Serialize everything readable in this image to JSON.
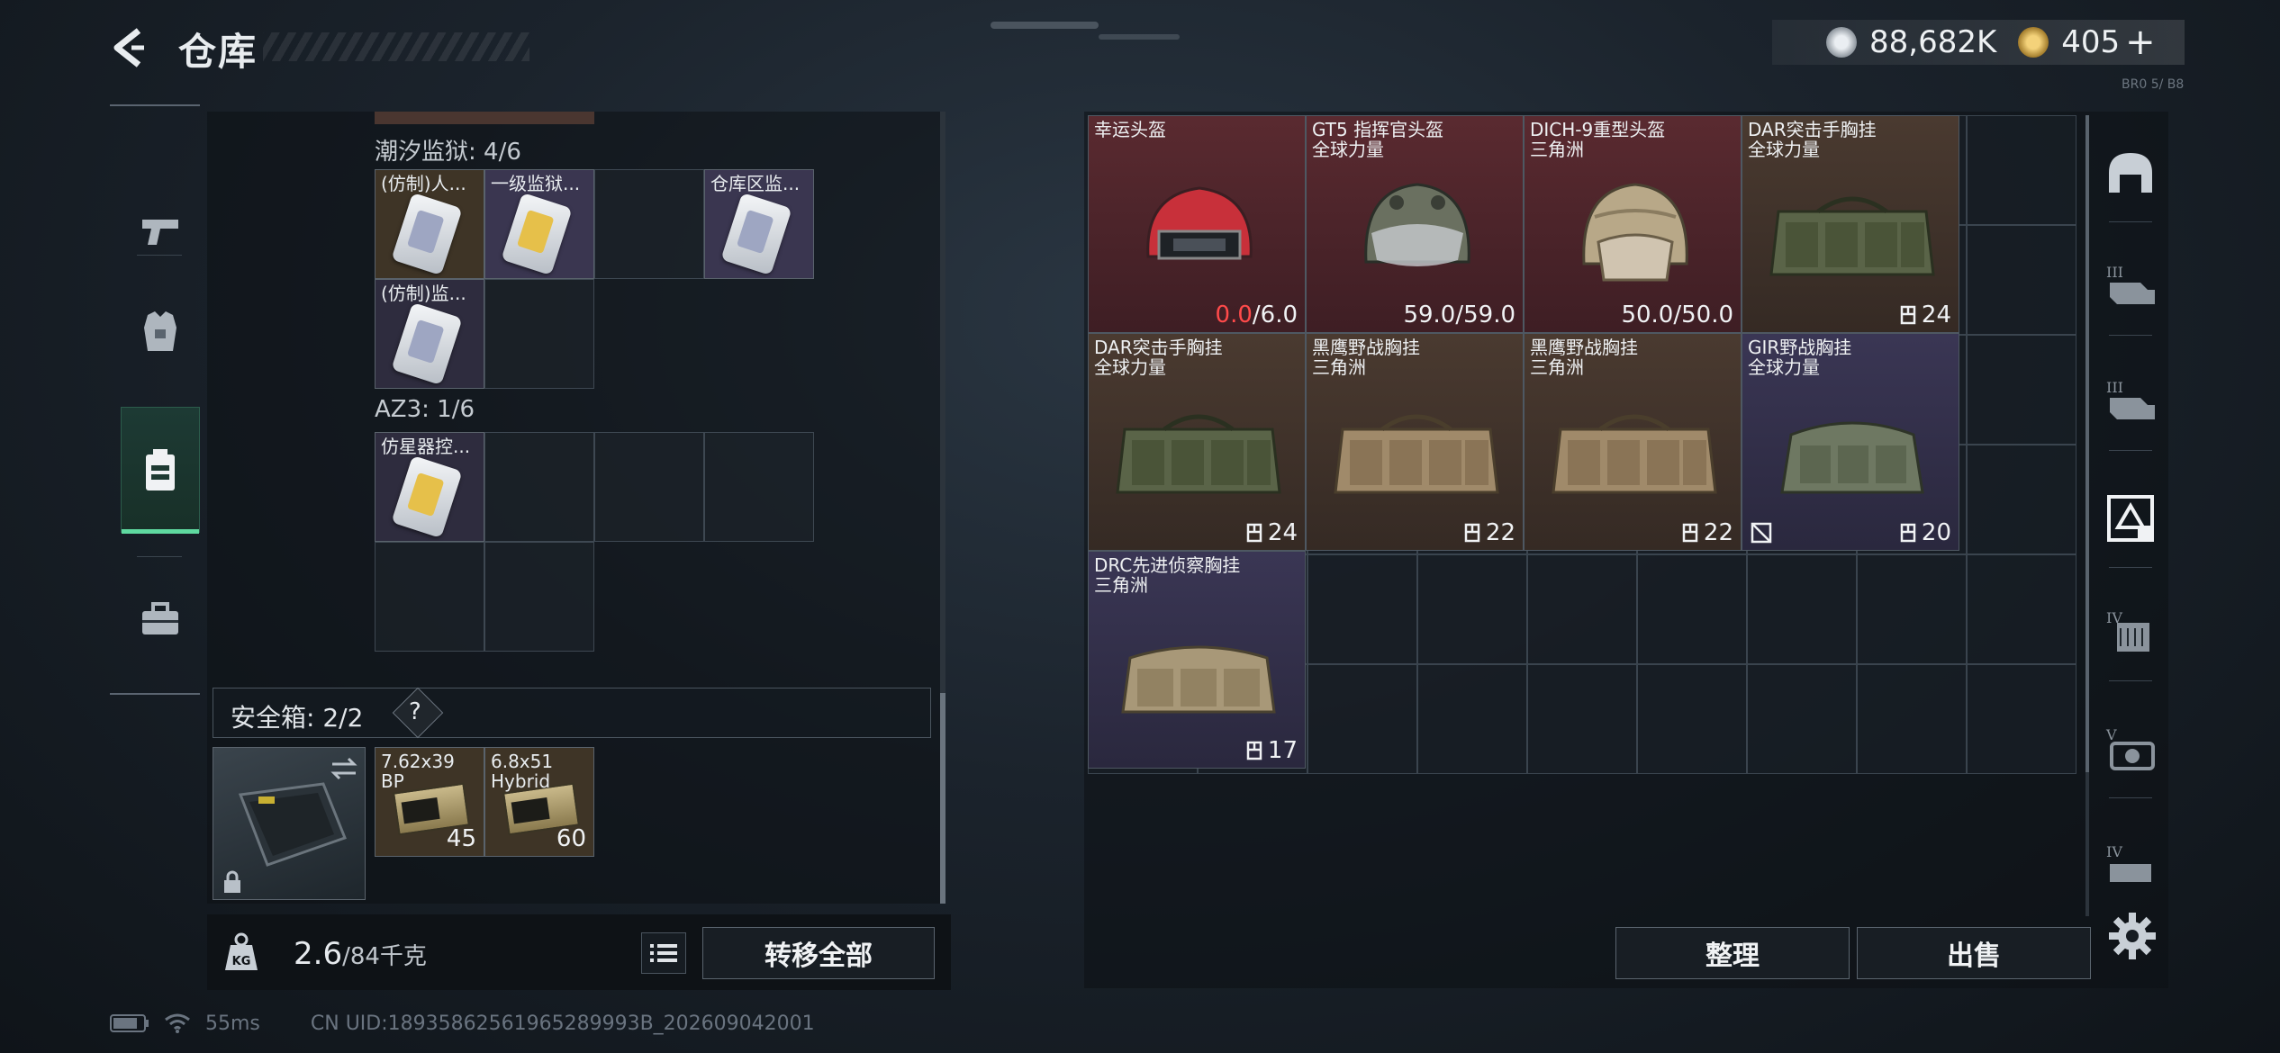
{
  "header": {
    "title": "仓库"
  },
  "currency": {
    "silver": "88,682K",
    "gold": "405",
    "gold_plus": "+"
  },
  "version_text": "BR0 5/ B8",
  "left_rail": {
    "items": [
      {
        "name": "weapons",
        "icon": "pistol-icon"
      },
      {
        "name": "armor",
        "icon": "armor-vest-icon"
      },
      {
        "name": "cards",
        "icon": "keycard-icon",
        "active": true
      },
      {
        "name": "supplies",
        "icon": "toolbox-icon"
      }
    ]
  },
  "sections": [
    {
      "title": "潮汐监狱: 4/6",
      "items": [
        {
          "label": "(仿制)人...",
          "color": "#3e3426",
          "card": "silver"
        },
        {
          "label": "一级监狱...",
          "color": "#3a3650",
          "card": "gold"
        },
        {
          "label": "仓库区监...",
          "color": "#3a3650",
          "card": "silver"
        },
        {
          "label": "(仿制)监...",
          "color": "#2e2c3e",
          "card": "silver"
        }
      ]
    },
    {
      "title": "AZ3: 1/6",
      "items": [
        {
          "label": "仿星器控...",
          "color": "#2e2c3e",
          "card": "gold"
        }
      ]
    }
  ],
  "safebox": {
    "label": "安全箱: 2/2",
    "help": "?",
    "ammo": [
      {
        "line1": "7.62x39",
        "line2": "BP",
        "count": "45"
      },
      {
        "line1": "6.8x51",
        "line2": "Hybrid",
        "count": "60"
      }
    ]
  },
  "weight": {
    "current": "2.6",
    "max": "/84千克"
  },
  "buttons": {
    "transfer_all": "转移全部",
    "sort": "整理",
    "sell": "出售"
  },
  "status": {
    "ping": "55ms",
    "uid": "CN UID:18935862561965289993B_202609042001"
  },
  "stash": [
    {
      "l1": "幸运头盔",
      "l2": "",
      "rarity": "red",
      "type": "helmet",
      "helmet_color": "#c8303a",
      "dur_cur": "0.0",
      "dur_max": "/6.0",
      "zero": true
    },
    {
      "l1": "GT5 指挥官头盔",
      "l2": "全球力量",
      "rarity": "red",
      "type": "helmet",
      "helmet_color": "#6a7060",
      "dur_cur": "59.0",
      "dur_max": "/59.0"
    },
    {
      "l1": "DICH-9重型头盔",
      "l2": "三角洲",
      "rarity": "red",
      "type": "helmet",
      "helmet_color": "#b8a888",
      "dur_cur": "50.0",
      "dur_max": "/50.0"
    },
    {
      "l1": "DAR突击手胸挂",
      "l2": "全球力量",
      "rarity": "brown",
      "type": "rig",
      "rig_color": "#5a6448",
      "cap": "24"
    },
    {
      "l1": "DAR突击手胸挂",
      "l2": "全球力量",
      "rarity": "brown",
      "type": "rig",
      "rig_color": "#5a6448",
      "cap": "24"
    },
    {
      "l1": "黑鹰野战胸挂",
      "l2": "三角洲",
      "rarity": "brown",
      "type": "rig",
      "rig_color": "#a08a6a",
      "cap": "22"
    },
    {
      "l1": "黑鹰野战胸挂",
      "l2": "三角洲",
      "rarity": "brown",
      "type": "rig",
      "rig_color": "#a08a6a",
      "cap": "22"
    },
    {
      "l1": "GIR野战胸挂",
      "l2": "全球力量",
      "rarity": "purple",
      "type": "rig",
      "rig_color": "#6e7862",
      "cap": "20",
      "nolock": true
    },
    {
      "l1": "DRC先进侦察胸挂",
      "l2": "三角洲",
      "rarity": "purple",
      "type": "rig",
      "rig_color": "#a89878",
      "cap": "17"
    }
  ],
  "right_rail": [
    {
      "icon": "helmet-category-icon",
      "tier": ""
    },
    {
      "icon": "armor-tier-icon",
      "tier": "III"
    },
    {
      "icon": "armor-tier-icon",
      "tier": "III"
    },
    {
      "icon": "rig-category-icon",
      "tier": ""
    },
    {
      "icon": "armor-tier-icon",
      "tier": "IV"
    },
    {
      "icon": "armor-tier-icon",
      "tier": "V"
    },
    {
      "icon": "armor-tier-icon",
      "tier": "IV"
    }
  ]
}
